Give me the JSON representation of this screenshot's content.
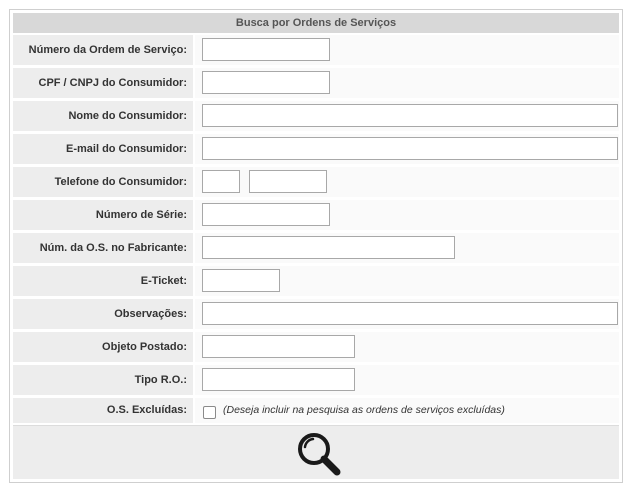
{
  "form": {
    "title": "Busca por Ordens de Serviços",
    "labels": {
      "numero_os": "Número da Ordem de Serviço:",
      "cpf_cnpj": "CPF / CNPJ do Consumidor:",
      "nome": "Nome do Consumidor:",
      "email": "E-mail do Consumidor:",
      "telefone": "Telefone do Consumidor:",
      "numero_serie": "Número de Série:",
      "os_fabricante": "Núm. da O.S. no Fabricante:",
      "eticket": "E-Ticket:",
      "observacoes": "Observações:",
      "objeto_postado": "Objeto Postado:",
      "tipo_ro": "Tipo R.O.:",
      "os_excluidas": "O.S. Excluídas:"
    },
    "values": {
      "numero_os": "",
      "cpf_cnpj": "",
      "nome": "",
      "email": "",
      "telefone_ddd": "",
      "telefone_numero": "",
      "numero_serie": "",
      "os_fabricante": "",
      "eticket": "",
      "observacoes": "",
      "objeto_postado": "",
      "tipo_ro": ""
    },
    "os_excluidas_checked": false,
    "os_excluidas_note": "(Deseja incluir na pesquisa as ordens de serviços excluídas)"
  },
  "search_button": {
    "icon": "magnifier-icon"
  }
}
